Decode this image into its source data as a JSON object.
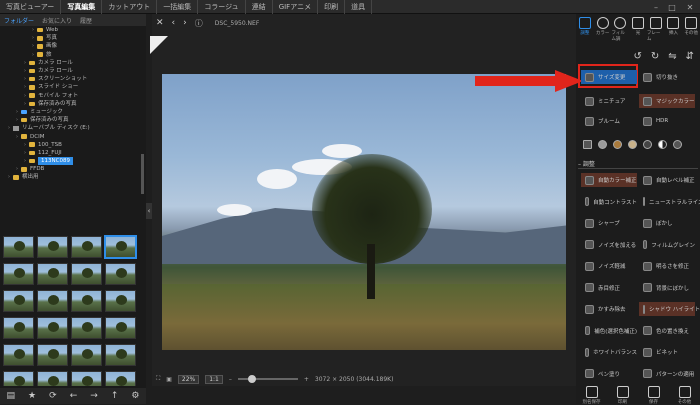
{
  "topnav": [
    "写真ビューアー",
    "写真編集",
    "カットアウト",
    "一括編集",
    "コラージュ",
    "連結",
    "GIFアニメ",
    "印刷",
    "道具"
  ],
  "topnav_active": 1,
  "left": {
    "tabs": [
      "フォルダー",
      "お気に入り",
      "履歴"
    ],
    "tree": [
      {
        "label": "Web",
        "depth": 4,
        "type": "folder"
      },
      {
        "label": "写真",
        "depth": 4,
        "type": "folder"
      },
      {
        "label": "画像",
        "depth": 4,
        "type": "folder"
      },
      {
        "label": "旅",
        "depth": 4,
        "type": "folder"
      },
      {
        "label": "カメラ ロール",
        "depth": 3,
        "type": "folder"
      },
      {
        "label": "カメラ ロール",
        "depth": 3,
        "type": "folder"
      },
      {
        "label": "スクリーンショット",
        "depth": 3,
        "type": "folder"
      },
      {
        "label": "スライド ショー",
        "depth": 3,
        "type": "folder"
      },
      {
        "label": "モバイル フォト",
        "depth": 3,
        "type": "folder"
      },
      {
        "label": "保存済みの写真",
        "depth": 3,
        "type": "folder"
      },
      {
        "label": "ミュージック",
        "depth": 2,
        "type": "music"
      },
      {
        "label": "保存済みの写真",
        "depth": 2,
        "type": "folder"
      },
      {
        "label": "リムーバブル ディスク (E:)",
        "depth": 1,
        "type": "drive"
      },
      {
        "label": "DCIM",
        "depth": 2,
        "type": "folder"
      },
      {
        "label": "100_TSB",
        "depth": 3,
        "type": "folder"
      },
      {
        "label": "112_FUJI",
        "depth": 3,
        "type": "folder"
      },
      {
        "label": "113NC089",
        "depth": 3,
        "type": "folder",
        "selected": true
      },
      {
        "label": "FFDB",
        "depth": 2,
        "type": "folder"
      },
      {
        "label": "横出用",
        "depth": 1,
        "type": "folder"
      }
    ],
    "thumb_count": 24,
    "thumb_selected": 3,
    "bottom_icons": [
      "layers-icon",
      "star-icon",
      "refresh-icon",
      "back-icon",
      "forward-icon",
      "up-icon",
      "settings-icon"
    ]
  },
  "viewer": {
    "filename": "DSC_5950.NEF",
    "zoom": "22%",
    "ratio": "1:1",
    "dimensions": "3072 × 2050 (3044.189K)"
  },
  "right": {
    "tools": [
      "調整",
      "カラー",
      "フィルム調",
      "光",
      "フレーム",
      "挿入",
      "その他"
    ],
    "tool_active": 0,
    "buttons_row1": [
      "サイズ変更",
      "切り抜き"
    ],
    "buttons_row2": [
      "ミニチュア",
      "マジックカラー"
    ],
    "buttons_row3": [
      "ブルーム",
      "HDR"
    ],
    "section_title": "調整",
    "adjust": [
      [
        "自動カラー補正",
        "自動レベル補正"
      ],
      [
        "自動コントラスト",
        "ニューストラルライズ"
      ],
      [
        "シャープ",
        "ぼかし"
      ],
      [
        "ノイズを加える",
        "フィルムグレイン"
      ],
      [
        "ノイズ軽減",
        "明るさを修正"
      ],
      [
        "赤目修正",
        "背景にぼかし"
      ],
      [
        "かすみ除去",
        "シャドウ ハイライト"
      ],
      [
        "補色(選択色補正)",
        "色の置き換え"
      ],
      [
        "ホワイトバランス",
        "ビネット"
      ],
      [
        "ペン塗り",
        "パターンの適用"
      ]
    ],
    "bottom": [
      "元に戻す",
      "やり直し",
      "元に戻す",
      "保存",
      "別名保存",
      "印刷",
      "保存",
      "その他"
    ]
  },
  "colors": {
    "accent": "#2f8ee8",
    "highlight": "#e1251b"
  }
}
